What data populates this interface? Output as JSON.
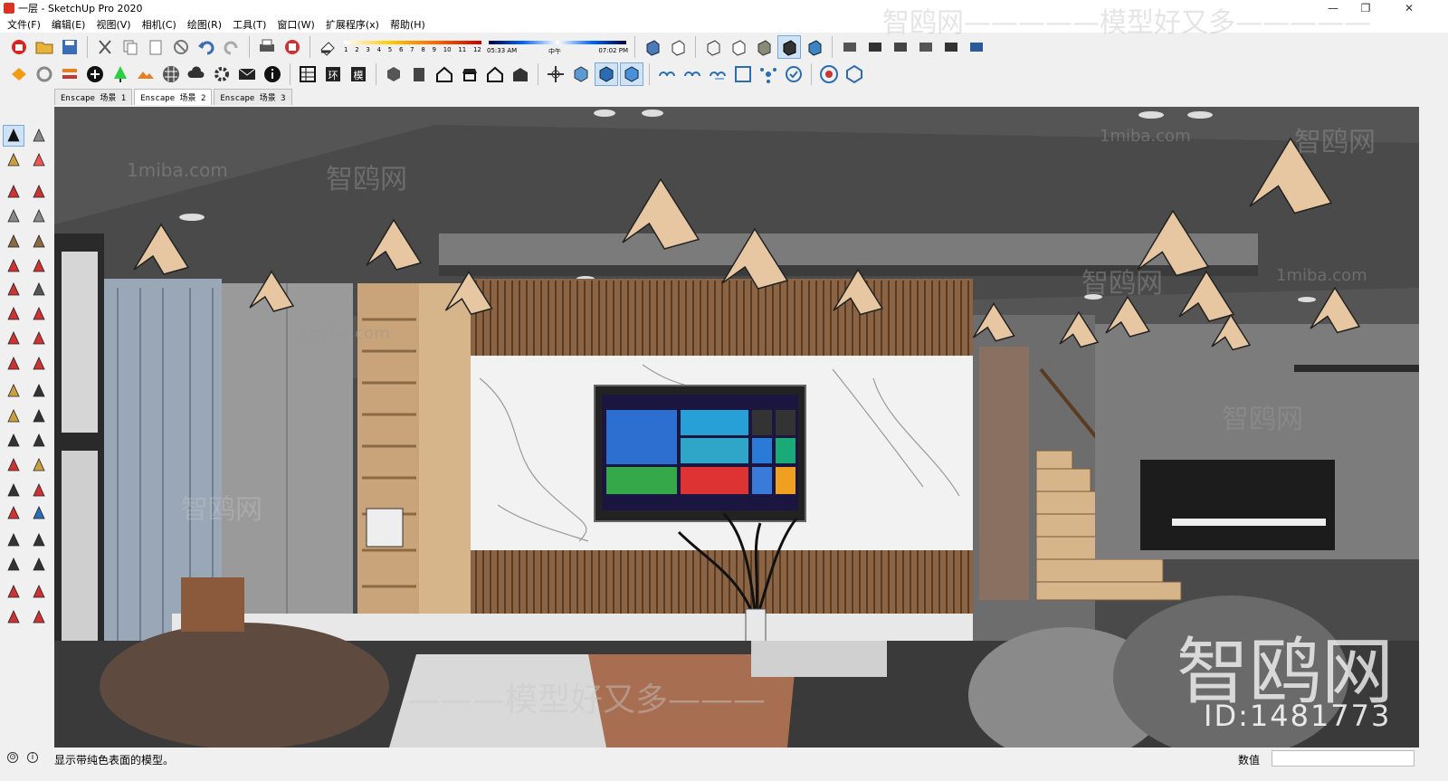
{
  "window": {
    "title": "一层 - SketchUp Pro 2020",
    "minimize": "—",
    "restore": "❐",
    "close": "✕"
  },
  "menu": [
    "文件(F)",
    "编辑(E)",
    "视图(V)",
    "相机(C)",
    "绘图(R)",
    "工具(T)",
    "窗口(W)",
    "扩展程序(x)",
    "帮助(H)"
  ],
  "shadow_ticks": [
    "1",
    "2",
    "3",
    "4",
    "5",
    "6",
    "7",
    "8",
    "9",
    "10",
    "11",
    "12"
  ],
  "time": {
    "start": "05:33 AM",
    "mid": "中午",
    "end": "07:02 PM"
  },
  "scenes": [
    "Enscape 场景 1",
    "Enscape 场景 2",
    "Enscape 场景 3"
  ],
  "active_scene": 1,
  "status": {
    "hint": "显示带纯色表面的模型。",
    "value_label": "数值",
    "value": ""
  },
  "watermarks": {
    "site": "1miba.com",
    "brand": "智鸥网",
    "dashes": "———————",
    "slogan": "智鸥网—————模型好又多—————",
    "slogan_bottom": "———模型好又多———",
    "big_logo": "智鸥网",
    "id": "ID:1481773"
  },
  "colors": {
    "accent": "#0078d7",
    "ceiling": "#4d4d4d",
    "wood": "#c9a47a",
    "marble": "#f2f2f2"
  }
}
